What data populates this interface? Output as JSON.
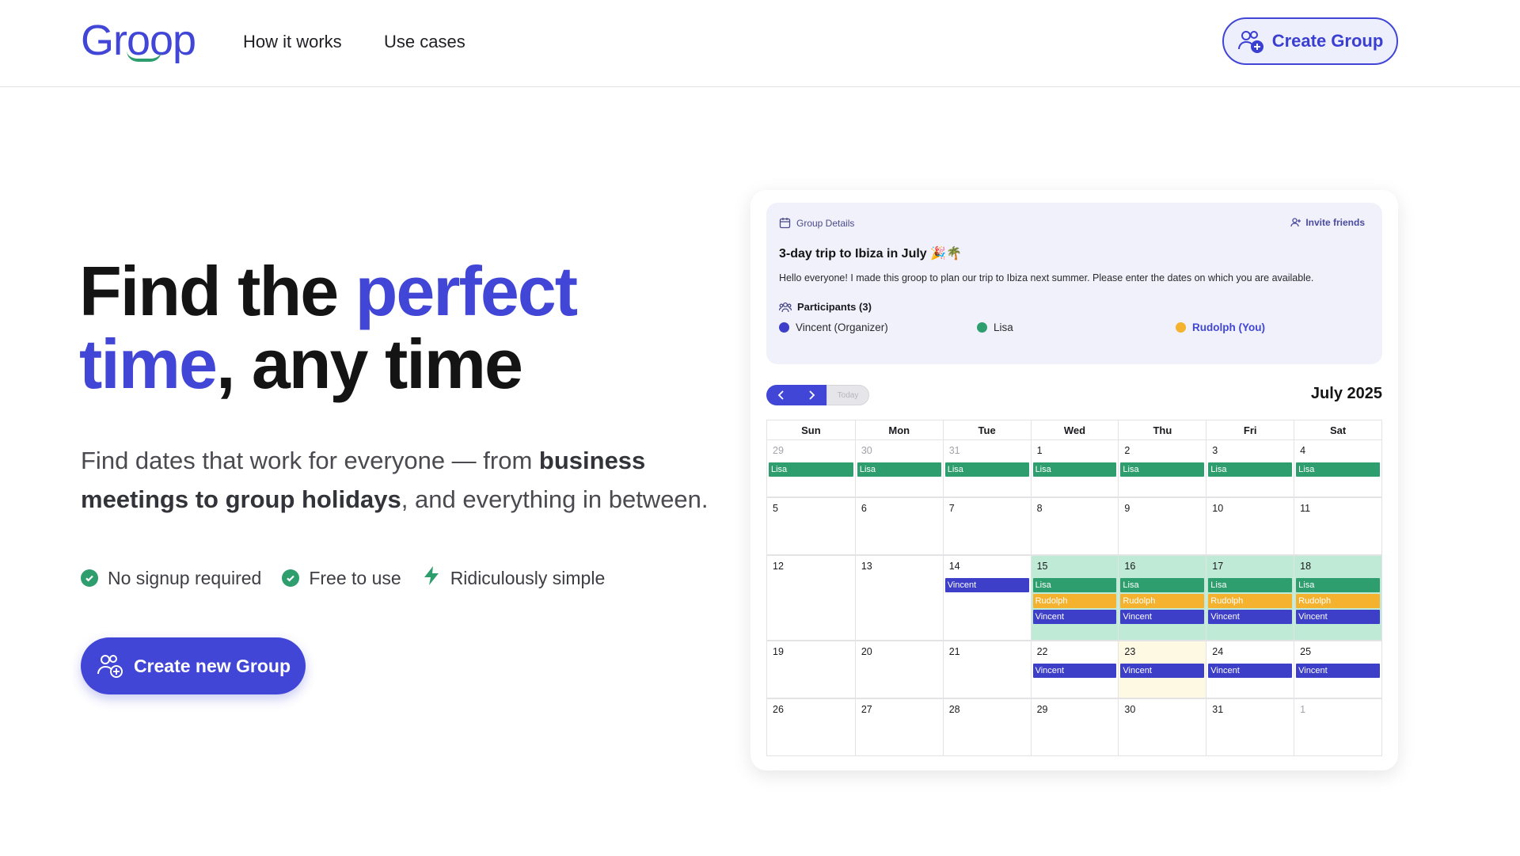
{
  "header": {
    "logo": "Groop",
    "nav": [
      "How it works",
      "Use cases"
    ],
    "cta": "Create Group"
  },
  "hero": {
    "title_part1": "Find the ",
    "title_accent1": "perfect",
    "title_accent2": "time",
    "title_part2": ", any time",
    "subtitle_part1": "Find dates that work for everyone — from ",
    "subtitle_bold": "business meetings to group holidays",
    "subtitle_part2": ", and everything in between.",
    "features": [
      "No signup required",
      "Free to use",
      "Ridiculously simple"
    ],
    "cta": "Create new Group"
  },
  "colors": {
    "accent": "#4146d6",
    "lisa": "#2f9e6e",
    "rudolph": "#f4b22e",
    "vincent": "#3d3fc8"
  },
  "group": {
    "section_label": "Group Details",
    "invite_label": "Invite friends",
    "title": "3-day trip to Ibiza in July 🎉🌴",
    "description": "Hello everyone! I made this groop to plan our trip to Ibiza next summer. Please enter the dates on which you are available.",
    "participants_label": "Participants (3)",
    "participants": [
      {
        "name": "Vincent (Organizer)",
        "color": "#3d3fc8"
      },
      {
        "name": "Lisa",
        "color": "#2f9e6e"
      },
      {
        "name": "Rudolph (You)",
        "color": "#f4b22e"
      }
    ]
  },
  "calendar": {
    "prev_icon": "chevron-left-icon",
    "next_icon": "chevron-right-icon",
    "today_label": "Today",
    "month_label": "July 2025",
    "weekdays": [
      "Sun",
      "Mon",
      "Tue",
      "Wed",
      "Thu",
      "Fri",
      "Sat"
    ],
    "weeks": [
      {
        "days": [
          {
            "n": "29",
            "muted": true,
            "events": [
              "Lisa"
            ]
          },
          {
            "n": "30",
            "muted": true,
            "events": [
              "Lisa"
            ]
          },
          {
            "n": "31",
            "muted": true,
            "events": [
              "Lisa"
            ]
          },
          {
            "n": "1",
            "events": [
              "Lisa"
            ]
          },
          {
            "n": "2",
            "events": [
              "Lisa"
            ]
          },
          {
            "n": "3",
            "events": [
              "Lisa"
            ]
          },
          {
            "n": "4",
            "events": [
              "Lisa"
            ]
          }
        ]
      },
      {
        "days": [
          {
            "n": "5",
            "events": []
          },
          {
            "n": "6",
            "events": []
          },
          {
            "n": "7",
            "events": []
          },
          {
            "n": "8",
            "events": []
          },
          {
            "n": "9",
            "events": []
          },
          {
            "n": "10",
            "events": []
          },
          {
            "n": "11",
            "events": []
          }
        ]
      },
      {
        "days": [
          {
            "n": "12",
            "events": []
          },
          {
            "n": "13",
            "events": []
          },
          {
            "n": "14",
            "events": [
              "Vincent"
            ]
          },
          {
            "n": "15",
            "hl": true,
            "events": [
              "Lisa",
              "Rudolph",
              "Vincent"
            ]
          },
          {
            "n": "16",
            "hl": true,
            "events": [
              "Lisa",
              "Rudolph",
              "Vincent"
            ]
          },
          {
            "n": "17",
            "hl": true,
            "events": [
              "Lisa",
              "Rudolph",
              "Vincent"
            ]
          },
          {
            "n": "18",
            "hl": true,
            "events": [
              "Lisa",
              "Rudolph",
              "Vincent"
            ]
          }
        ]
      },
      {
        "days": [
          {
            "n": "19",
            "events": []
          },
          {
            "n": "20",
            "events": []
          },
          {
            "n": "21",
            "events": []
          },
          {
            "n": "22",
            "events": [
              "Vincent"
            ]
          },
          {
            "n": "23",
            "today": true,
            "events": [
              "Vincent"
            ]
          },
          {
            "n": "24",
            "events": [
              "Vincent"
            ]
          },
          {
            "n": "25",
            "events": [
              "Vincent"
            ]
          }
        ]
      },
      {
        "days": [
          {
            "n": "26",
            "events": []
          },
          {
            "n": "27",
            "events": []
          },
          {
            "n": "28",
            "events": []
          },
          {
            "n": "29",
            "events": []
          },
          {
            "n": "30",
            "events": []
          },
          {
            "n": "31",
            "events": []
          },
          {
            "n": "1",
            "muted": true,
            "events": []
          }
        ]
      }
    ]
  }
}
